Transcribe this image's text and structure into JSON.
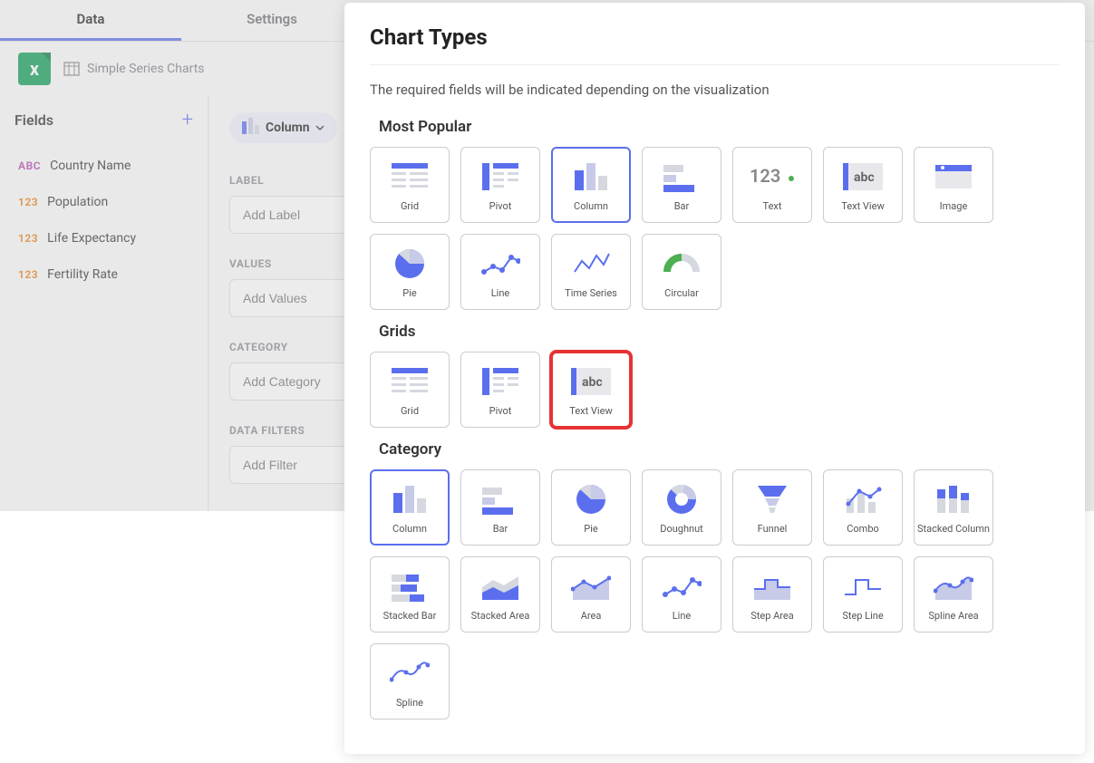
{
  "tabs": {
    "data": "Data",
    "settings": "Settings"
  },
  "datasource": {
    "name": "Simple Series Charts"
  },
  "fields": {
    "title": "Fields",
    "items": [
      {
        "type": "ABC",
        "label": "Country Name"
      },
      {
        "type": "123",
        "label": "Population"
      },
      {
        "type": "123",
        "label": "Life Expectancy"
      },
      {
        "type": "123",
        "label": "Fertility Rate"
      }
    ]
  },
  "config": {
    "viz": "Column",
    "sections": {
      "label": {
        "title": "LABEL",
        "placeholder": "Add Label"
      },
      "values": {
        "title": "VALUES",
        "placeholder": "Add Values"
      },
      "category": {
        "title": "CATEGORY",
        "placeholder": "Add Category"
      },
      "filters": {
        "title": "DATA FILTERS",
        "placeholder": "Add Filter"
      }
    }
  },
  "chartTypes": {
    "title": "Chart Types",
    "desc": "The required fields will be indicated depending on the visualization",
    "sections": [
      {
        "title": "Most Popular",
        "items": [
          {
            "id": "grid",
            "label": "Grid"
          },
          {
            "id": "pivot",
            "label": "Pivot"
          },
          {
            "id": "column",
            "label": "Column",
            "selected": true
          },
          {
            "id": "bar",
            "label": "Bar"
          },
          {
            "id": "text",
            "label": "Text"
          },
          {
            "id": "textview",
            "label": "Text View"
          },
          {
            "id": "image",
            "label": "Image"
          },
          {
            "id": "pie",
            "label": "Pie"
          },
          {
            "id": "line",
            "label": "Line"
          },
          {
            "id": "timeseries",
            "label": "Time Series"
          },
          {
            "id": "circular",
            "label": "Circular"
          }
        ]
      },
      {
        "title": "Grids",
        "items": [
          {
            "id": "grid",
            "label": "Grid"
          },
          {
            "id": "pivot",
            "label": "Pivot"
          },
          {
            "id": "textview",
            "label": "Text View",
            "highlighted": true
          }
        ]
      },
      {
        "title": "Category",
        "items": [
          {
            "id": "column",
            "label": "Column",
            "selected": true
          },
          {
            "id": "bar",
            "label": "Bar"
          },
          {
            "id": "pie",
            "label": "Pie"
          },
          {
            "id": "doughnut",
            "label": "Doughnut"
          },
          {
            "id": "funnel",
            "label": "Funnel"
          },
          {
            "id": "combo",
            "label": "Combo"
          },
          {
            "id": "stackedcolumn",
            "label": "Stacked Column"
          },
          {
            "id": "stackedbar",
            "label": "Stacked Bar"
          },
          {
            "id": "stackedarea",
            "label": "Stacked Area"
          },
          {
            "id": "area",
            "label": "Area"
          },
          {
            "id": "line",
            "label": "Line"
          },
          {
            "id": "steparea",
            "label": "Step Area"
          },
          {
            "id": "stepline",
            "label": "Step Line"
          },
          {
            "id": "splinearea",
            "label": "Spline Area"
          },
          {
            "id": "spline",
            "label": "Spline"
          }
        ]
      }
    ]
  }
}
